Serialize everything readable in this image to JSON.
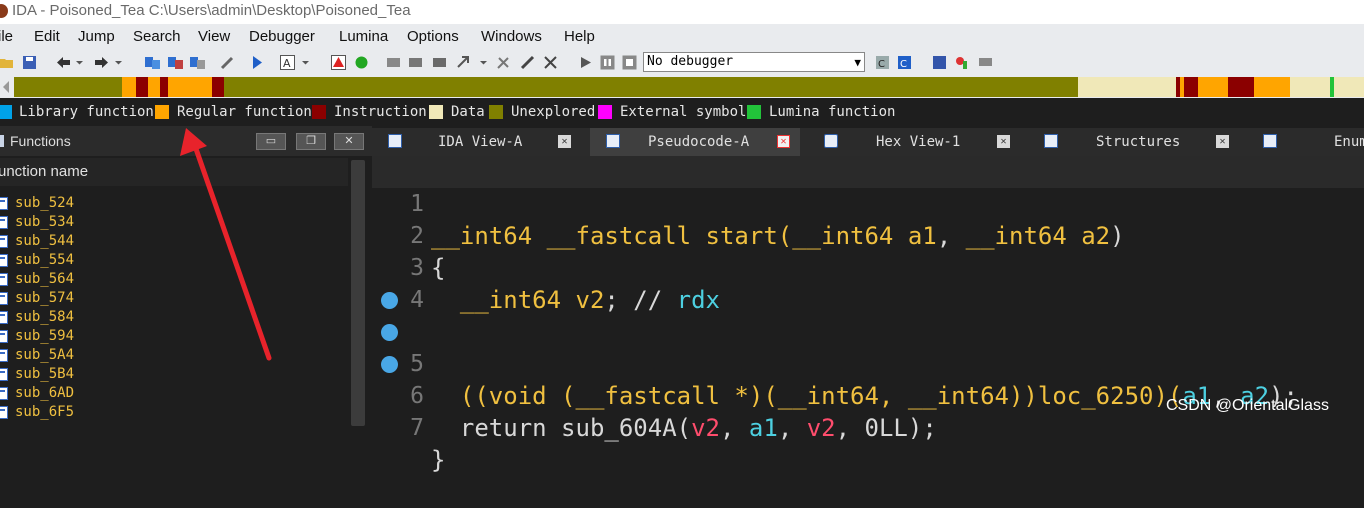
{
  "window": {
    "title": "IDA - Poisoned_Tea C:\\Users\\admin\\Desktop\\Poisoned_Tea"
  },
  "menu": [
    "ile",
    "Edit",
    "Jump",
    "Search",
    "View",
    "Debugger",
    "Lumina",
    "Options",
    "Windows",
    "Help"
  ],
  "toolbar": {
    "debugger_select": "No debugger"
  },
  "legend": [
    {
      "label": "Library function",
      "color": "#00a2e8"
    },
    {
      "label": "Regular function",
      "color": "#ffa500"
    },
    {
      "label": "Instruction",
      "color": "#8b0000"
    },
    {
      "label": "Data",
      "color": "#f0e8b8"
    },
    {
      "label": "Unexplored",
      "color": "#808000"
    },
    {
      "label": "External symbol",
      "color": "#ff00ff"
    },
    {
      "label": "Lumina function",
      "color": "#22c33a"
    }
  ],
  "functions_panel": {
    "title": "Functions",
    "column_header": "unction name",
    "items": [
      "sub_524",
      "sub_534",
      "sub_544",
      "sub_554",
      "sub_564",
      "sub_574",
      "sub_584",
      "sub_594",
      "sub_5A4",
      "sub_5B4",
      "sub_6AD",
      "sub_6F5"
    ]
  },
  "tabs": [
    {
      "label": "IDA View-A",
      "active": false
    },
    {
      "label": "Pseudocode-A",
      "active": true
    },
    {
      "label": "Hex View-1",
      "active": false
    },
    {
      "label": "Structures",
      "active": false
    },
    {
      "label": "Enum",
      "active": false
    }
  ],
  "code": {
    "line_numbers": [
      "1",
      "2",
      "3",
      "4",
      "5",
      "6",
      "7"
    ],
    "l1": {
      "t1": "__int64 __fastcall start(",
      "t2": "__int64 a1",
      "t3": ", ",
      "t4": "__int64 a2",
      "t5": ")"
    },
    "l2": "{",
    "l3": {
      "t1": "  __int64 v2",
      "t2": "; // ",
      "t3": "rdx"
    },
    "l5": {
      "t1": "  ((void (__fastcall *)(__int64, __int64))loc_6250)(",
      "t2": "a1",
      "t3": ", ",
      "t4": "a2",
      "t5": ");"
    },
    "l6": {
      "t1": "  return sub_604A(",
      "t2": "v2",
      "t3": ", ",
      "t4": "a1",
      "t5": ", ",
      "t6": "v2",
      "t7": ", 0LL);"
    },
    "l7": "}"
  },
  "watermark": "CSDN @OrientalGlass"
}
